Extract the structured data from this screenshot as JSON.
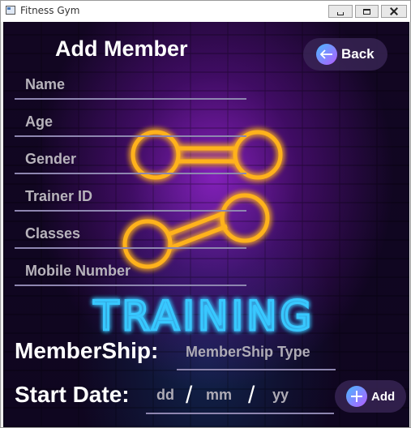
{
  "window": {
    "title": "Fitness Gym",
    "controls": [
      "minimize",
      "maximize",
      "close"
    ]
  },
  "header": {
    "title": "Add Member",
    "back_label": "Back",
    "back_icon": "arrow-left-icon"
  },
  "form": {
    "fields": [
      {
        "key": "name",
        "label": "Name"
      },
      {
        "key": "age",
        "label": "Age"
      },
      {
        "key": "gender",
        "label": "Gender"
      },
      {
        "key": "trainer_id",
        "label": "Trainer ID"
      },
      {
        "key": "classes",
        "label": "Classes"
      },
      {
        "key": "mobile",
        "label": "Mobile Number"
      }
    ],
    "membership_label": "MemberShip:",
    "membership_placeholder": "MemberShip Type",
    "start_date_label": "Start Date:",
    "date_dd": "dd",
    "date_mm": "mm",
    "date_yy": "yy",
    "date_separator": "/",
    "add_label": "Add",
    "add_icon": "plus-icon"
  },
  "background": {
    "neon_text": "TRAINING",
    "dumbbell_color": "#ffb21a",
    "neon_text_color": "#39c8ff"
  }
}
